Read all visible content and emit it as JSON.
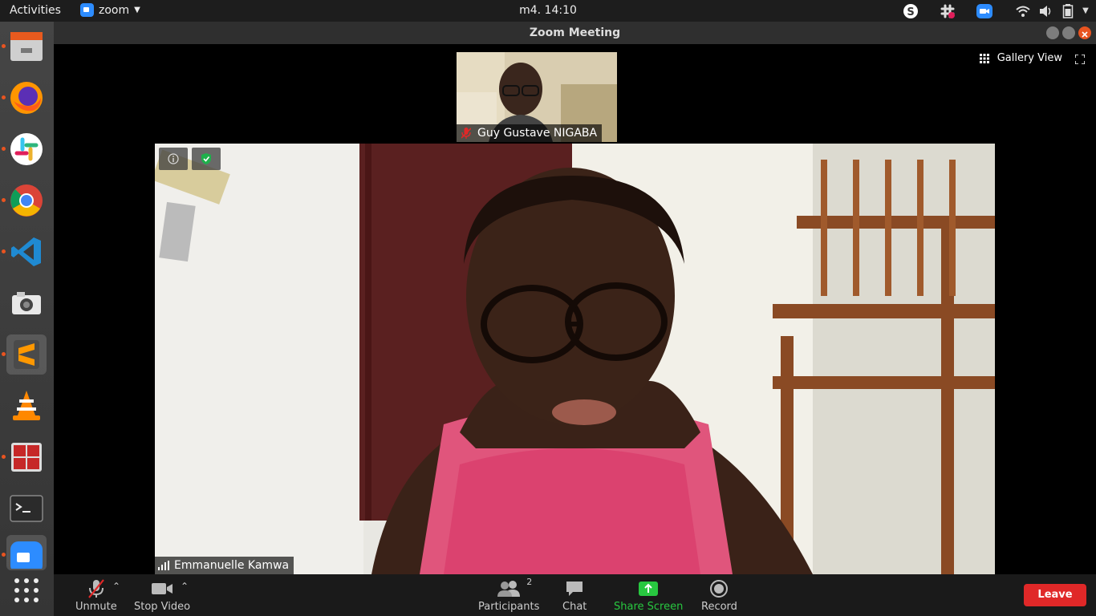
{
  "topbar": {
    "activities": "Activities",
    "app_name": "zoom",
    "clock": "m4. 14:10"
  },
  "window": {
    "title": "Zoom Meeting"
  },
  "view": {
    "gallery_view_label": "Gallery View"
  },
  "participants": {
    "thumbnail_name": "Guy Gustave NIGABA",
    "active_speaker_name": "Emmanuelle Kamwa"
  },
  "toolbar": {
    "unmute": "Unmute",
    "stop_video": "Stop Video",
    "participants": "Participants",
    "participants_count": "2",
    "chat": "Chat",
    "share_screen": "Share Screen",
    "record": "Record",
    "leave": "Leave"
  },
  "colors": {
    "share_accent": "#28c840",
    "leave_red": "#e02828",
    "zoom_blue": "#2d8cff"
  },
  "dock_icons": [
    "files-icon",
    "firefox-icon",
    "slack-icon",
    "chrome-icon",
    "vscode-icon",
    "camera-icon",
    "sublime-icon",
    "vlc-icon",
    "terminal-apps-icon",
    "terminal-icon",
    "zoom-icon",
    "show-apps-icon"
  ]
}
